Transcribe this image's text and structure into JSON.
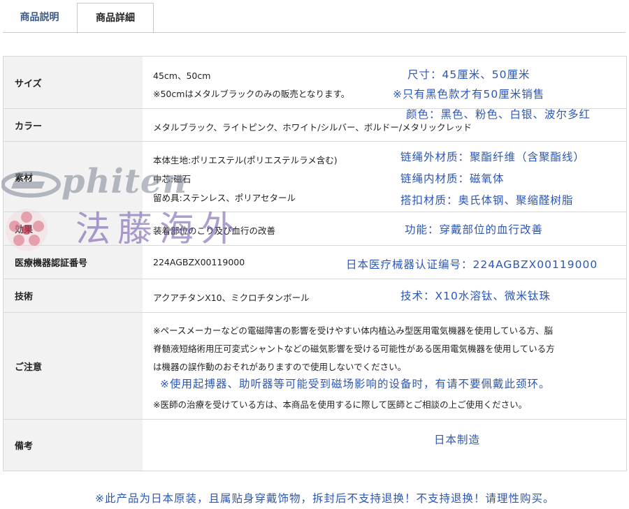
{
  "tabs": [
    {
      "label": "商品説明"
    },
    {
      "label": "商品詳細"
    }
  ],
  "rows": {
    "size": {
      "label": "サイズ",
      "lines": [
        "45cm、50cm",
        "※50cmはメタルブラックのみの販売となります。"
      ],
      "cn": [
        "尺寸：45厘米、50厘米",
        "※只有黑色款才有50厘米销售"
      ]
    },
    "color": {
      "label": "カラー",
      "lines": [
        "メタルブラック、ライトピンク、ホワイト/シルバー、ボルドー/メタリックレッド"
      ],
      "cn": [
        "颜色：黑色、粉色、白银、波尔多红"
      ]
    },
    "material": {
      "label": "素材",
      "lines": [
        "本体生地:ポリエステル(ポリエステルラメ含む)",
        "中芯:磁石",
        "留め具:ステンレス、ポリアセタール"
      ],
      "cn": [
        "链绳外材质：聚酯纤维（含聚酯线）",
        "链绳内材质：磁氧体",
        "搭扣材质：奥氏体钢、聚缩醛树脂"
      ]
    },
    "effect": {
      "label": "効果",
      "lines": [
        "装着部位のこり及び血行の改善"
      ],
      "cn": [
        "功能：穿戴部位的血行改善"
      ]
    },
    "cert": {
      "label": "医療機器認証番号",
      "lines": [
        "224AGBZX00119000"
      ],
      "cn": [
        "日本医疗械器认证编号：224AGBZX00119000"
      ]
    },
    "tech": {
      "label": "技術",
      "lines": [
        "アクアチタンX10、ミクロチタンボール"
      ],
      "cn": [
        "技术：X10水溶钛、微米钛珠"
      ]
    },
    "caution": {
      "label": "ご注意",
      "lines": [
        "※ペースメーカーなどの電磁障害の影響を受けやすい体内植込み型医用電気機器を使用している方、脳",
        "脊髄液短絡術用圧可変式シャントなどの磁気影響を受ける可能性がある医用電気機器を使用している方",
        "は機器の誤作動のおそれがありますので使用しないでください。",
        "※医師の治療を受けている方は、本商品を使用するに際して医師とご相談の上ご使用ください。"
      ],
      "cn": [
        "※使用起搏器、助听器等可能受到磁场影响的设备时，有请不要佩戴此颈环。"
      ]
    },
    "remarks": {
      "label": "備考",
      "lines": [],
      "cn": [
        "日本制造"
      ]
    }
  },
  "footer_note": "※此产品为日本原装，且属贴身穿戴饰物，拆封后不支持退换！不支持退换！请理性购买。",
  "watermark": {
    "logo_text": "phiten",
    "cn_text": "法藤海外"
  },
  "colors": {
    "accent_blue": "#2d57b4",
    "tab_active_text": "#3a5a8c",
    "label_bg": "#f2f2f2",
    "border": "#d8d8d8"
  }
}
